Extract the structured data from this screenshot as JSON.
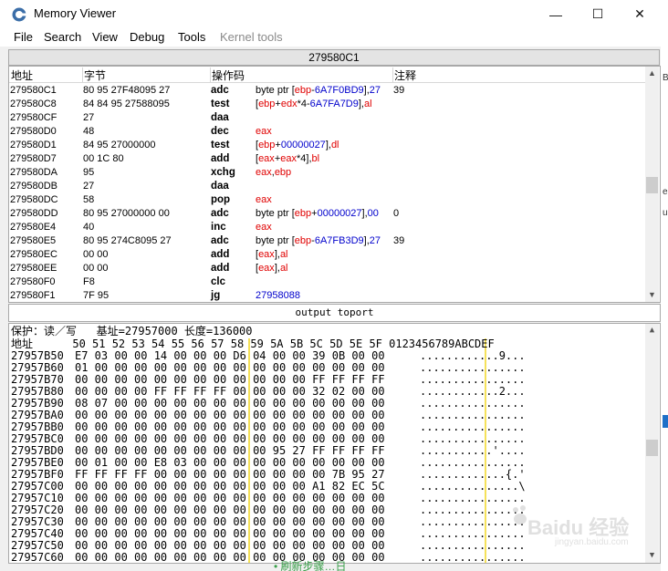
{
  "window": {
    "title": "Memory Viewer",
    "controls": {
      "minimize": "—",
      "maximize": "☐",
      "close": "✕"
    }
  },
  "menu": [
    "File",
    "Search",
    "View",
    "Debug",
    "Tools",
    "Kernel tools"
  ],
  "address_header": "279580C1",
  "disasm": {
    "columns": [
      "地址",
      "字节",
      "操作码",
      "注释"
    ],
    "rows": [
      {
        "addr": "279580C1",
        "bytes": "80 95 27F48095 27",
        "op": "adc",
        "operands": [
          {
            "t": "byte ptr [",
            "c": "#000"
          },
          {
            "t": "ebp",
            "c": "#e00000"
          },
          {
            "t": "-",
            "c": "#000"
          },
          {
            "t": "6A7F0BD9",
            "c": "#0000cc"
          },
          {
            "t": "],",
            "c": "#000"
          },
          {
            "t": "27",
            "c": "#0000cc"
          }
        ],
        "comment": "39"
      },
      {
        "addr": "279580C8",
        "bytes": "84 84 95 27588095",
        "op": "test",
        "operands": [
          {
            "t": "[",
            "c": "#000"
          },
          {
            "t": "ebp",
            "c": "#e00000"
          },
          {
            "t": "+",
            "c": "#000"
          },
          {
            "t": "edx",
            "c": "#e00000"
          },
          {
            "t": "*4-",
            "c": "#000"
          },
          {
            "t": "6A7FA7D9",
            "c": "#0000cc"
          },
          {
            "t": "],",
            "c": "#000"
          },
          {
            "t": "al",
            "c": "#e00000"
          }
        ],
        "comment": ""
      },
      {
        "addr": "279580CF",
        "bytes": "27",
        "op": "daa",
        "operands": [],
        "comment": ""
      },
      {
        "addr": "279580D0",
        "bytes": "48",
        "op": "dec",
        "operands": [
          {
            "t": "eax",
            "c": "#e00000"
          }
        ],
        "comment": ""
      },
      {
        "addr": "279580D1",
        "bytes": "84 95 27000000",
        "op": "test",
        "operands": [
          {
            "t": "[",
            "c": "#000"
          },
          {
            "t": "ebp",
            "c": "#e00000"
          },
          {
            "t": "+",
            "c": "#000"
          },
          {
            "t": "00000027",
            "c": "#0000cc"
          },
          {
            "t": "],",
            "c": "#000"
          },
          {
            "t": "dl",
            "c": "#e00000"
          }
        ],
        "comment": ""
      },
      {
        "addr": "279580D7",
        "bytes": "00 1C 80",
        "op": "add",
        "operands": [
          {
            "t": "[",
            "c": "#000"
          },
          {
            "t": "eax",
            "c": "#e00000"
          },
          {
            "t": "+",
            "c": "#000"
          },
          {
            "t": "eax",
            "c": "#e00000"
          },
          {
            "t": "*4],",
            "c": "#000"
          },
          {
            "t": "bl",
            "c": "#e00000"
          }
        ],
        "comment": ""
      },
      {
        "addr": "279580DA",
        "bytes": "95",
        "op": "xchg",
        "operands": [
          {
            "t": "eax",
            "c": "#e00000"
          },
          {
            "t": ",",
            "c": "#000"
          },
          {
            "t": "ebp",
            "c": "#e00000"
          }
        ],
        "comment": ""
      },
      {
        "addr": "279580DB",
        "bytes": "27",
        "op": "daa",
        "operands": [],
        "comment": ""
      },
      {
        "addr": "279580DC",
        "bytes": "58",
        "op": "pop",
        "operands": [
          {
            "t": "eax",
            "c": "#e00000"
          }
        ],
        "comment": ""
      },
      {
        "addr": "279580DD",
        "bytes": "80 95 27000000 00",
        "op": "adc",
        "operands": [
          {
            "t": "byte ptr [",
            "c": "#000"
          },
          {
            "t": "ebp",
            "c": "#e00000"
          },
          {
            "t": "+",
            "c": "#000"
          },
          {
            "t": "00000027",
            "c": "#0000cc"
          },
          {
            "t": "],",
            "c": "#000"
          },
          {
            "t": "00",
            "c": "#0000cc"
          }
        ],
        "comment": "0"
      },
      {
        "addr": "279580E4",
        "bytes": "40",
        "op": "inc",
        "operands": [
          {
            "t": "eax",
            "c": "#e00000"
          }
        ],
        "comment": ""
      },
      {
        "addr": "279580E5",
        "bytes": "80 95 274C8095 27",
        "op": "adc",
        "operands": [
          {
            "t": "byte ptr [",
            "c": "#000"
          },
          {
            "t": "ebp",
            "c": "#e00000"
          },
          {
            "t": "-",
            "c": "#000"
          },
          {
            "t": "6A7FB3D9",
            "c": "#0000cc"
          },
          {
            "t": "],",
            "c": "#000"
          },
          {
            "t": "27",
            "c": "#0000cc"
          }
        ],
        "comment": "39"
      },
      {
        "addr": "279580EC",
        "bytes": "00 00",
        "op": "add",
        "operands": [
          {
            "t": "[",
            "c": "#000"
          },
          {
            "t": "eax",
            "c": "#e00000"
          },
          {
            "t": "],",
            "c": "#000"
          },
          {
            "t": "al",
            "c": "#e00000"
          }
        ],
        "comment": ""
      },
      {
        "addr": "279580EE",
        "bytes": "00 00",
        "op": "add",
        "operands": [
          {
            "t": "[",
            "c": "#000"
          },
          {
            "t": "eax",
            "c": "#e00000"
          },
          {
            "t": "],",
            "c": "#000"
          },
          {
            "t": "al",
            "c": "#e00000"
          }
        ],
        "comment": ""
      },
      {
        "addr": "279580F0",
        "bytes": "F8",
        "op": "clc",
        "operands": [],
        "comment": ""
      },
      {
        "addr": "279580F1",
        "bytes": "7F 95",
        "op": "jg",
        "operands": [
          {
            "t": "27958088",
            "c": "#0000cc"
          }
        ],
        "comment": ""
      }
    ]
  },
  "middle_bar": "output toport",
  "hex": {
    "info": "保护：读／写   基址=27957000 长度=136000",
    "header": "地址      50 51 52 53 54 55 56 57 58 59 5A 5B 5C 5D 5E 5F 0123456789ABCDEF",
    "rows": [
      {
        "addr": "27957B50",
        "bytes": "E7 03 00 00 14 00 00 00 D6 04 00 00 39 0B 00 00",
        "ascii": "............9..."
      },
      {
        "addr": "27957B60",
        "bytes": "01 00 00 00 00 00 00 00 00 00 00 00 00 00 00 00",
        "ascii": "................"
      },
      {
        "addr": "27957B70",
        "bytes": "00 00 00 00 00 00 00 00 00 00 00 00 FF FF FF FF",
        "ascii": "................"
      },
      {
        "addr": "27957B80",
        "bytes": "00 00 00 00 FF FF FF FF 00 00 00 00 32 02 00 00",
        "ascii": "............2..."
      },
      {
        "addr": "27957B90",
        "bytes": "08 07 00 00 00 00 00 00 00 00 00 00 00 00 00 00",
        "ascii": "................"
      },
      {
        "addr": "27957BA0",
        "bytes": "00 00 00 00 00 00 00 00 00 00 00 00 00 00 00 00",
        "ascii": "................"
      },
      {
        "addr": "27957BB0",
        "bytes": "00 00 00 00 00 00 00 00 00 00 00 00 00 00 00 00",
        "ascii": "................"
      },
      {
        "addr": "27957BC0",
        "bytes": "00 00 00 00 00 00 00 00 00 00 00 00 00 00 00 00",
        "ascii": "................"
      },
      {
        "addr": "27957BD0",
        "bytes": "00 00 00 00 00 00 00 00 00 00 95 27 FF FF FF FF",
        "ascii": "...........'...."
      },
      {
        "addr": "27957BE0",
        "bytes": "00 01 00 00 E8 03 00 00 00 00 00 00 00 00 00 00",
        "ascii": "................"
      },
      {
        "addr": "27957BF0",
        "bytes": "FF FF FF FF 00 00 00 00 00 00 00 00 00 7B 95 27",
        "ascii": ".............{.'"
      },
      {
        "addr": "27957C00",
        "bytes": "00 00 00 00 00 00 00 00 00 00 00 00 A1 82 EC 5C",
        "ascii": "...............\\"
      },
      {
        "addr": "27957C10",
        "bytes": "00 00 00 00 00 00 00 00 00 00 00 00 00 00 00 00",
        "ascii": "................"
      },
      {
        "addr": "27957C20",
        "bytes": "00 00 00 00 00 00 00 00 00 00 00 00 00 00 00 00",
        "ascii": "................"
      },
      {
        "addr": "27957C30",
        "bytes": "00 00 00 00 00 00 00 00 00 00 00 00 00 00 00 00",
        "ascii": "................"
      },
      {
        "addr": "27957C40",
        "bytes": "00 00 00 00 00 00 00 00 00 00 00 00 00 00 00 00",
        "ascii": "................"
      },
      {
        "addr": "27957C50",
        "bytes": "00 00 00 00 00 00 00 00 00 00 00 00 00 00 00 00",
        "ascii": "................"
      },
      {
        "addr": "27957C60",
        "bytes": "00 00 00 00 00 00 00 00 00 00 00 00 00 00 00 00",
        "ascii": "................"
      }
    ]
  },
  "side_fragments": [
    "B.",
    "e",
    "u"
  ],
  "bottom_fragment": "• 刷新步骤…日",
  "watermark": {
    "text": "Baidu 经验",
    "sub": "jingyan.baidu.com"
  }
}
